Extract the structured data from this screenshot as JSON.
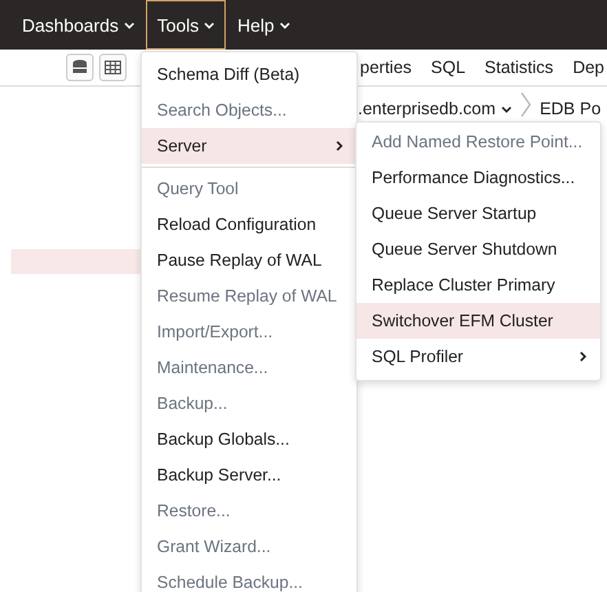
{
  "menubar": [
    {
      "label": "Dashboards",
      "selected": false
    },
    {
      "label": "Tools",
      "selected": true
    },
    {
      "label": "Help",
      "selected": false
    }
  ],
  "tabs": [
    "perties",
    "SQL",
    "Statistics",
    "Dep"
  ],
  "breadcrumb": [
    {
      "label": ".enterprisedb.com",
      "kind": "dropdown"
    },
    {
      "label": "EDB Po",
      "kind": "plain"
    }
  ],
  "tools_menu": {
    "groups": [
      [
        {
          "label": "Schema Diff (Beta)",
          "disabled": false,
          "selected": false,
          "kind": "item"
        },
        {
          "label": "Search Objects...",
          "disabled": true,
          "selected": false,
          "kind": "item"
        },
        {
          "label": "Server",
          "disabled": false,
          "selected": true,
          "kind": "submenu"
        }
      ],
      [
        {
          "label": "Query Tool",
          "disabled": true,
          "selected": false,
          "kind": "item"
        },
        {
          "label": "Reload Configuration",
          "disabled": false,
          "selected": false,
          "kind": "item"
        },
        {
          "label": "Pause Replay of WAL",
          "disabled": false,
          "selected": false,
          "kind": "item"
        },
        {
          "label": "Resume Replay of WAL",
          "disabled": true,
          "selected": false,
          "kind": "item"
        },
        {
          "label": "Import/Export...",
          "disabled": true,
          "selected": false,
          "kind": "item"
        },
        {
          "label": "Maintenance...",
          "disabled": true,
          "selected": false,
          "kind": "item"
        },
        {
          "label": "Backup...",
          "disabled": true,
          "selected": false,
          "kind": "item"
        },
        {
          "label": "Backup Globals...",
          "disabled": false,
          "selected": false,
          "kind": "item"
        },
        {
          "label": "Backup Server...",
          "disabled": false,
          "selected": false,
          "kind": "item"
        },
        {
          "label": "Restore...",
          "disabled": true,
          "selected": false,
          "kind": "item"
        },
        {
          "label": "Grant Wizard...",
          "disabled": true,
          "selected": false,
          "kind": "item"
        },
        {
          "label": "Schedule Backup...",
          "disabled": true,
          "selected": false,
          "kind": "item"
        }
      ]
    ]
  },
  "server_submenu": [
    {
      "label": "Add Named Restore Point...",
      "disabled": true,
      "selected": false,
      "kind": "item"
    },
    {
      "label": "Performance Diagnostics...",
      "disabled": false,
      "selected": false,
      "kind": "item"
    },
    {
      "label": "Queue Server Startup",
      "disabled": false,
      "selected": false,
      "kind": "item"
    },
    {
      "label": "Queue Server Shutdown",
      "disabled": false,
      "selected": false,
      "kind": "item"
    },
    {
      "label": "Replace Cluster Primary",
      "disabled": false,
      "selected": false,
      "kind": "item"
    },
    {
      "label": "Switchover EFM Cluster",
      "disabled": false,
      "selected": true,
      "kind": "item"
    },
    {
      "label": "SQL Profiler",
      "disabled": false,
      "selected": false,
      "kind": "submenu"
    }
  ]
}
